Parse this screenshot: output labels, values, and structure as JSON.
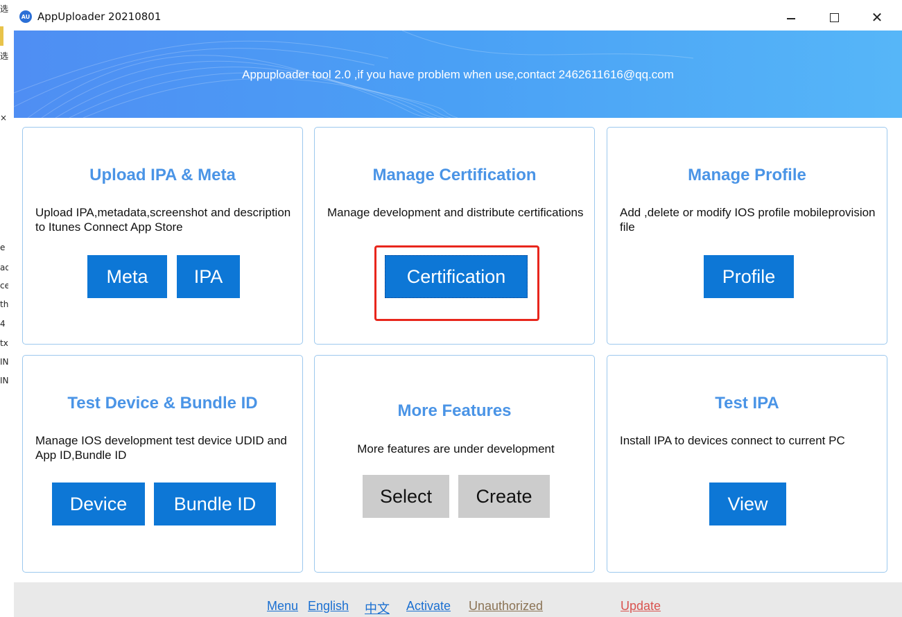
{
  "window": {
    "title": "AppUploader 20210801",
    "icon_text": "AU"
  },
  "banner": {
    "text": "Appuploader tool 2.0 ,if you have problem when use,contact 2462611616@qq.com"
  },
  "cards": {
    "upload": {
      "title": "Upload IPA & Meta",
      "description": "Upload IPA,metadata,screenshot and description to Itunes Connect App Store",
      "buttons": [
        "Meta",
        "IPA"
      ]
    },
    "certification": {
      "title": "Manage Certification",
      "description": "Manage development and distribute certifications",
      "buttons": [
        "Certification"
      ]
    },
    "profile": {
      "title": "Manage Profile",
      "description": "Add ,delete or modify IOS profile mobileprovision file",
      "buttons": [
        "Profile"
      ]
    },
    "device": {
      "title": "Test Device & Bundle ID",
      "description": "Manage IOS development test device UDID and App ID,Bundle ID",
      "buttons": [
        "Device",
        "Bundle ID"
      ]
    },
    "more": {
      "title": "More Features",
      "description": "More features are under development",
      "buttons": [
        "Select",
        "Create"
      ]
    },
    "test": {
      "title": "Test IPA",
      "description": "Install IPA to devices connect to current PC",
      "buttons": [
        "View"
      ]
    }
  },
  "footer": {
    "links": [
      {
        "label": "Menu",
        "color": "#1a6fd1"
      },
      {
        "label": "English",
        "color": "#1a6fd1"
      },
      {
        "label": "中文",
        "color": "#1a6fd1"
      },
      {
        "label": "Activate",
        "color": "#1a6fd1"
      },
      {
        "label": "Unauthorized",
        "color": "#8b7355"
      },
      {
        "label": "Update",
        "color": "#d9534f"
      }
    ]
  },
  "background_strip": {
    "glyphs": [
      "选",
      "×",
      "e",
      "ad",
      "ce",
      "th",
      "4",
      "tx",
      "IN",
      "IN"
    ]
  },
  "colors": {
    "accent": "#0d77d6",
    "title_blue": "#4a94e6",
    "highlight_red": "#e8261c",
    "card_border": "#9cc8ee"
  }
}
